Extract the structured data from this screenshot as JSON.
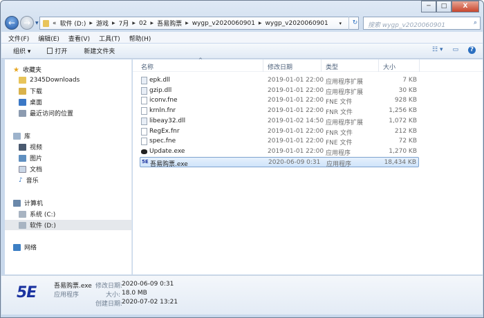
{
  "window": {
    "min": "─",
    "max": "□",
    "close": "X"
  },
  "address": {
    "overflow": "«",
    "crumbs": [
      "软件 (D:)",
      "游戏",
      "7月",
      "02",
      "吾易购票",
      "wygp_v2020060901",
      "wygp_v2020060901"
    ],
    "dropdown": "▾",
    "refresh": "↻"
  },
  "search": {
    "placeholder": "搜索 wygp_v2020060901",
    "icon": "⌕"
  },
  "menu": [
    "文件(F)",
    "编辑(E)",
    "查看(V)",
    "工具(T)",
    "帮助(H)"
  ],
  "toolbar": {
    "organize": "组织 ▾",
    "open": "打开",
    "new_folder": "新建文件夹",
    "view": "☷ ▾",
    "preview": "▭",
    "help": "?"
  },
  "nav": {
    "favorites": {
      "label": "收藏夹",
      "items": [
        "2345Downloads",
        "下载",
        "桌面",
        "最近访问的位置"
      ]
    },
    "libraries": {
      "label": "库",
      "items": [
        "视频",
        "图片",
        "文档",
        "音乐"
      ]
    },
    "computer": {
      "label": "计算机",
      "items": [
        "系统 (C:)",
        "软件 (D:)"
      ]
    },
    "network": {
      "label": "网络"
    }
  },
  "columns": {
    "name": "名称",
    "date": "修改日期",
    "type": "类型",
    "size": "大小"
  },
  "files": [
    {
      "name": "epk.dll",
      "date": "2019-01-01 22:00",
      "type": "应用程序扩展",
      "size": "7 KB"
    },
    {
      "name": "gzip.dll",
      "date": "2019-01-01 22:00",
      "type": "应用程序扩展",
      "size": "30 KB"
    },
    {
      "name": "iconv.fne",
      "date": "2019-01-01 22:00",
      "type": "FNE 文件",
      "size": "928 KB"
    },
    {
      "name": "krnln.fnr",
      "date": "2019-01-01 22:00",
      "type": "FNR 文件",
      "size": "1,256 KB"
    },
    {
      "name": "libeay32.dll",
      "date": "2019-01-02 14:50",
      "type": "应用程序扩展",
      "size": "1,072 KB"
    },
    {
      "name": "RegEx.fnr",
      "date": "2019-01-01 22:00",
      "type": "FNR 文件",
      "size": "212 KB"
    },
    {
      "name": "spec.fne",
      "date": "2019-01-01 22:00",
      "type": "FNE 文件",
      "size": "72 KB"
    },
    {
      "name": "Update.exe",
      "date": "2019-01-01 22:00",
      "type": "应用程序",
      "size": "1,270 KB"
    },
    {
      "name": "吾易购票.exe",
      "date": "2020-06-09 0:31",
      "type": "应用程序",
      "size": "18,434 KB"
    }
  ],
  "details": {
    "logo": "5E",
    "name": "吾易购票.exe",
    "kind": "应用程序",
    "modified_label": "修改日期:",
    "modified": "2020-06-09 0:31",
    "size_label": "大小:",
    "size": "18.0 MB",
    "created_label": "创建日期:",
    "created": "2020-07-02 13:21"
  }
}
